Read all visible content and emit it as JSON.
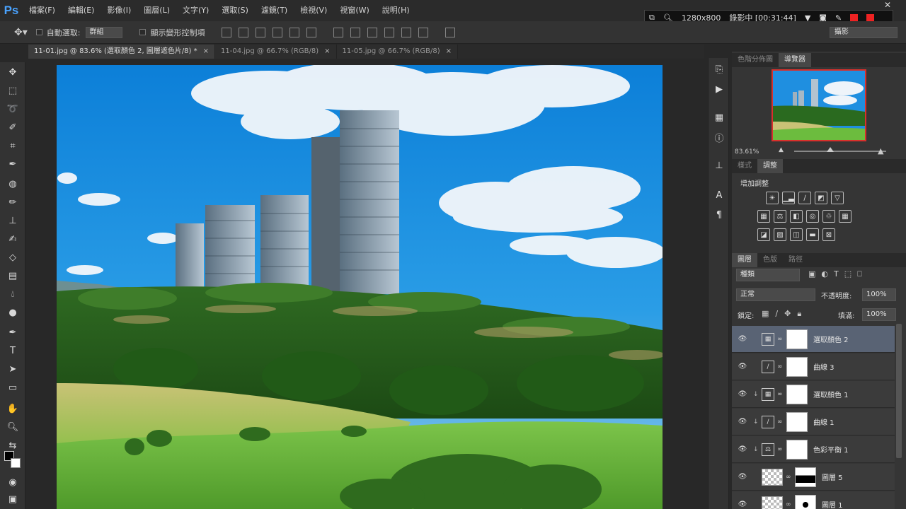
{
  "app": {
    "logo": "Ps"
  },
  "menu": [
    "檔案(F)",
    "編輯(E)",
    "影像(I)",
    "圖層(L)",
    "文字(Y)",
    "選取(S)",
    "濾鏡(T)",
    "檢視(V)",
    "視窗(W)",
    "說明(H)"
  ],
  "recorder": {
    "size": "1280x800",
    "status": "錄影中 [00:31:44]"
  },
  "options": {
    "auto_select_label": "自動選取:",
    "auto_select_value": "群組",
    "transform_label": "顯示變形控制項",
    "workspace_value": "攝影"
  },
  "tabs": [
    {
      "label": "11-01.jpg @ 83.6% (選取顏色 2, 圖層遮色片/8) *"
    },
    {
      "label": "11-04.jpg @ 66.7% (RGB/8)"
    },
    {
      "label": "11-05.jpg @ 66.7% (RGB/8)"
    }
  ],
  "navigator": {
    "tabs": [
      "色階分佈圖",
      "導覽器"
    ],
    "zoom": "83.61%"
  },
  "adjustments": {
    "tabs": [
      "樣式",
      "調整"
    ],
    "title": "增加調整"
  },
  "layers_panel": {
    "tabs": [
      "圖層",
      "色版",
      "路徑"
    ],
    "filter": "種類",
    "blend_mode": "正常",
    "opacity_label": "不透明度:",
    "opacity_value": "100%",
    "lock_label": "鎖定:",
    "fill_label": "填滿:",
    "fill_value": "100%",
    "layers": [
      {
        "name": "選取顏色 2",
        "selected": true,
        "clipped": false,
        "glyph": "SC"
      },
      {
        "name": "曲線 3",
        "selected": false,
        "clipped": false,
        "glyph": "CV"
      },
      {
        "name": "選取顏色 1",
        "selected": false,
        "clipped": true,
        "glyph": "SC"
      },
      {
        "name": "曲線 1",
        "selected": false,
        "clipped": true,
        "glyph": "CV"
      },
      {
        "name": "色彩平衡 1",
        "selected": false,
        "clipped": true,
        "glyph": "CB"
      },
      {
        "name": "圖層 5",
        "selected": false,
        "clipped": false,
        "glyph": ""
      },
      {
        "name": "圖層 1",
        "selected": false,
        "clipped": false,
        "glyph": ""
      }
    ]
  },
  "colors": {
    "accent": "#596374",
    "nav_frame": "#d9302c"
  }
}
